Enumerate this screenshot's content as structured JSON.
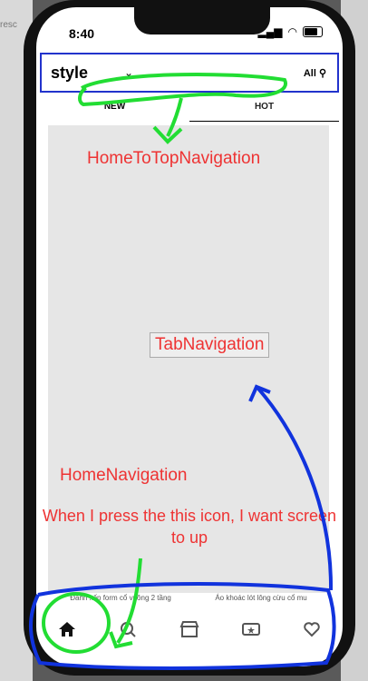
{
  "status": {
    "time": "8:40"
  },
  "header": {
    "logo": "style",
    "location": "All"
  },
  "tabs": [
    {
      "label": "NEW"
    },
    {
      "label": "HOT"
    }
  ],
  "annotations": {
    "home_to_top": "HomeToTopNavigation",
    "tab_navigation": "TabNavigation",
    "home_navigation": "HomeNavigation",
    "press_note": "When I press the this icon, I want screen to up"
  },
  "products": [
    "Đánh xốp form cổ vuông 2 tầng",
    "Áo khoác lót lông cừu cổ mu"
  ],
  "bottom_nav": [
    "home-icon",
    "search-icon",
    "store-icon",
    "ticket-star-icon",
    "heart-icon"
  ],
  "colors": {
    "annotation_red": "#ee3333",
    "annotation_green": "#22dd33",
    "annotation_blue": "#1133dd"
  }
}
